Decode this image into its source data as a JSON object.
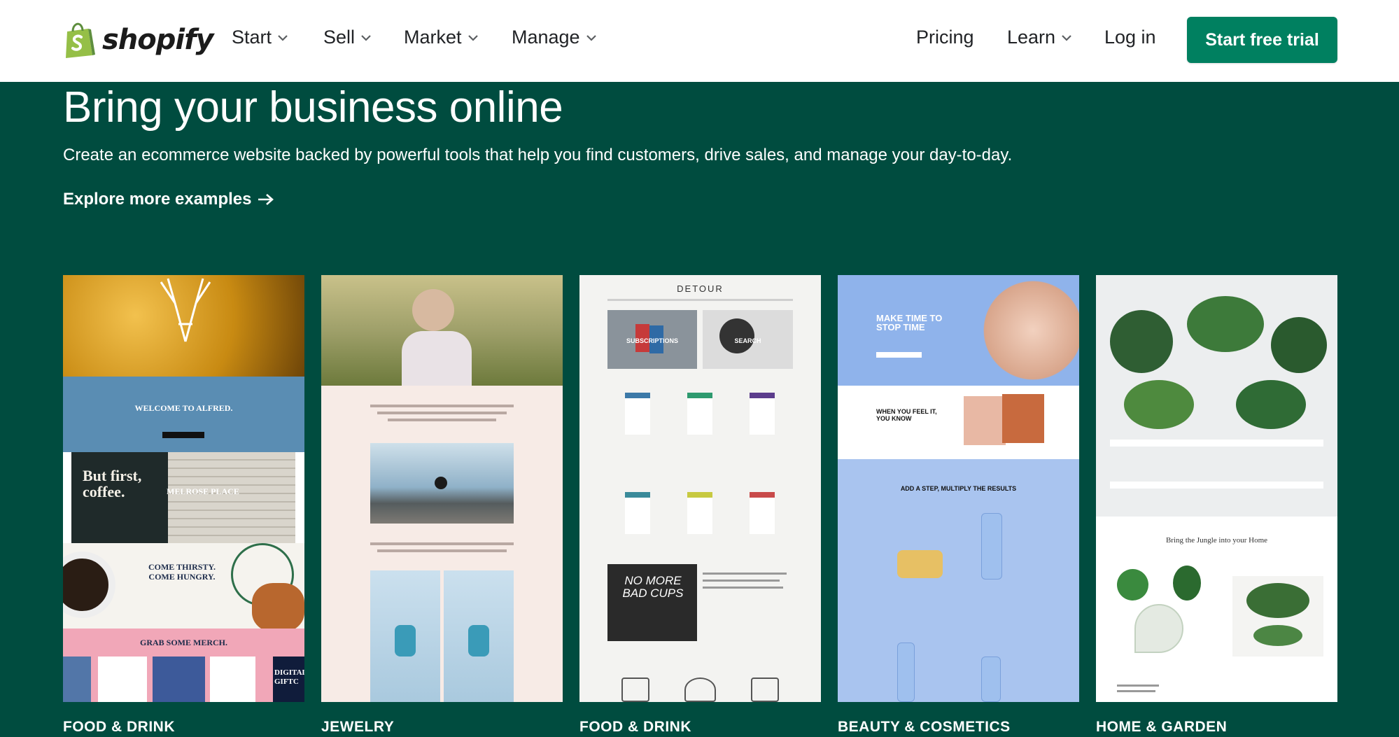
{
  "nav": {
    "brand": "shopify",
    "menu": [
      "Start",
      "Sell",
      "Market",
      "Manage"
    ],
    "pricing": "Pricing",
    "learn": "Learn",
    "login": "Log in",
    "cta": "Start free trial"
  },
  "hero": {
    "title": "Bring your business online",
    "subtitle": "Create an ecommerce website backed by powerful tools that help you find customers, drive sales, and manage your day-to-day.",
    "explore": "Explore more examples"
  },
  "cards": [
    {
      "category": "FOOD & DRINK",
      "texts": [
        "WELCOME TO ALFRED.",
        "But first, coffee.",
        "MELROSE PLACE",
        "COME THIRSTY. COME HUNGRY.",
        "GRAB SOME MERCH.",
        "DIGITAL GIFTC"
      ]
    },
    {
      "category": "JEWELRY",
      "texts": []
    },
    {
      "category": "FOOD & DRINK",
      "texts": [
        "DETOUR",
        "SUBSCRIPTIONS",
        "SEARCH",
        "NO MORE BAD CUPS"
      ]
    },
    {
      "category": "BEAUTY & COSMETICS",
      "texts": [
        "MAKE TIME TO STOP TIME",
        "WHEN YOU FEEL IT, YOU KNOW",
        "ADD A STEP, MULTIPLY THE RESULTS"
      ]
    },
    {
      "category": "HOME & GARDEN",
      "texts": [
        "Bring the Jungle into your Home"
      ]
    }
  ],
  "colors": {
    "hero_bg": "#004c3f",
    "cta_bg": "#008060",
    "brand_green": "#95bf47"
  }
}
